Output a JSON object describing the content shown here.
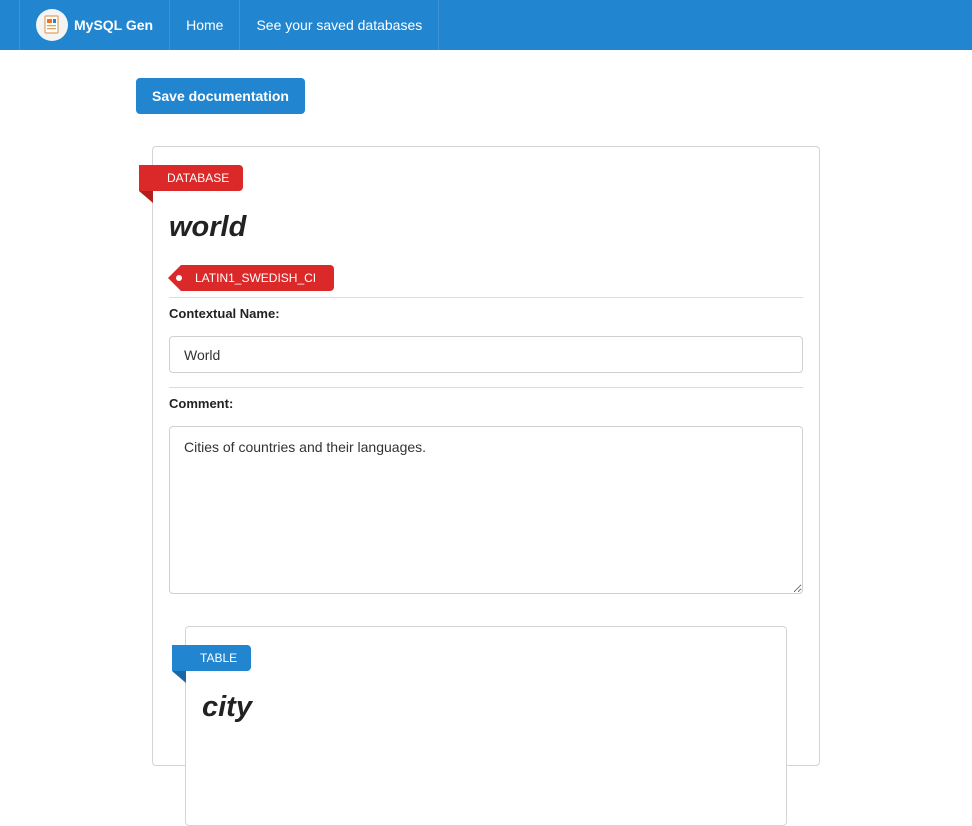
{
  "navbar": {
    "brand": "MySQL Gen",
    "items": [
      {
        "label": "Home"
      },
      {
        "label": "See your saved databases"
      }
    ]
  },
  "toolbar": {
    "save_label": "Save documentation"
  },
  "database": {
    "ribbon_label": "DATABASE",
    "name": "world",
    "collation": "LATIN1_SWEDISH_CI",
    "contextual_name_label": "Contextual Name:",
    "contextual_name_value": "World",
    "comment_label": "Comment:",
    "comment_value": "Cities of countries and their languages."
  },
  "table": {
    "ribbon_label": "TABLE",
    "name": "city"
  },
  "colors": {
    "primary": "#2185d0",
    "red": "#db2828"
  }
}
